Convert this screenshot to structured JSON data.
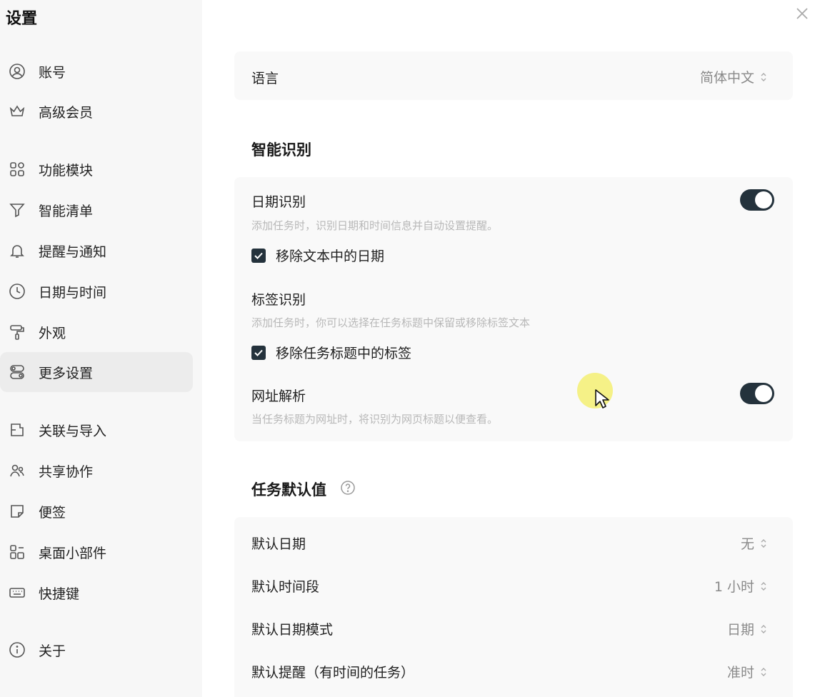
{
  "app": {
    "title": "设置"
  },
  "sidebar": {
    "items": [
      {
        "label": "账号",
        "icon": "user-circle-icon"
      },
      {
        "label": "高级会员",
        "icon": "crown-icon"
      },
      {
        "label": "功能模块",
        "icon": "grid-icon"
      },
      {
        "label": "智能清单",
        "icon": "filter-icon"
      },
      {
        "label": "提醒与通知",
        "icon": "bell-icon"
      },
      {
        "label": "日期与时间",
        "icon": "clock-icon"
      },
      {
        "label": "外观",
        "icon": "paint-roller-icon"
      },
      {
        "label": "更多设置",
        "icon": "toggles-icon",
        "active": true
      },
      {
        "label": "关联与导入",
        "icon": "import-icon"
      },
      {
        "label": "共享协作",
        "icon": "people-icon"
      },
      {
        "label": "便签",
        "icon": "note-icon"
      },
      {
        "label": "桌面小部件",
        "icon": "widget-icon"
      },
      {
        "label": "快捷键",
        "icon": "keyboard-icon"
      },
      {
        "label": "关于",
        "icon": "info-icon"
      }
    ]
  },
  "language": {
    "label": "语言",
    "value": "简体中文"
  },
  "smart_recognition": {
    "title": "智能识别",
    "date": {
      "label": "日期识别",
      "desc": "添加任务时，识别日期和时间信息并自动设置提醒。",
      "enabled": true,
      "checkbox_label": "移除文本中的日期",
      "checked": true
    },
    "tag": {
      "label": "标签识别",
      "desc": "添加任务时，你可以选择在任务标题中保留或移除标签文本",
      "checkbox_label": "移除任务标题中的标签",
      "checked": true
    },
    "url": {
      "label": "网址解析",
      "desc": "当任务标题为网址时，将识别为网页标题以便查看。",
      "enabled": true
    }
  },
  "task_defaults": {
    "title": "任务默认值",
    "rows": [
      {
        "label": "默认日期",
        "value": "无"
      },
      {
        "label": "默认时间段",
        "value": "1 小时"
      },
      {
        "label": "默认日期模式",
        "value": "日期"
      },
      {
        "label": "默认提醒（有时间的任务）",
        "value": "准时"
      }
    ]
  },
  "colors": {
    "accent": "#24323c",
    "sidebar_bg": "#f7f7f7",
    "panel_bg": "#f9f9f9",
    "muted_text": "#b8b8b8"
  }
}
